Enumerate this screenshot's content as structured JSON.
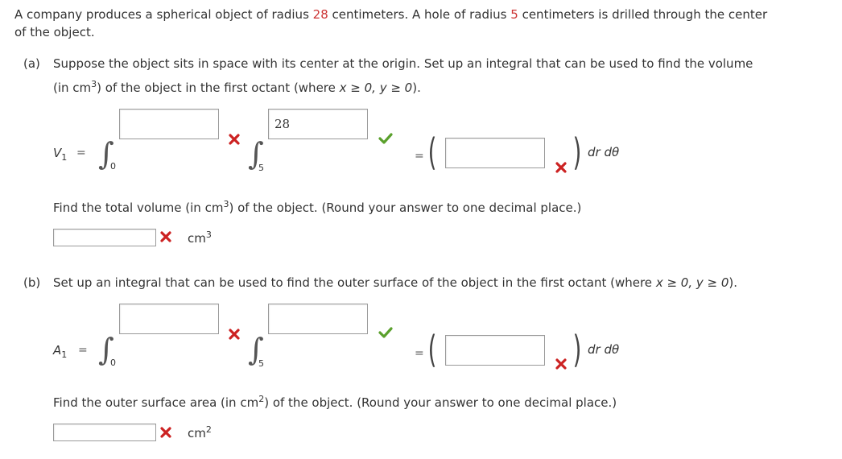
{
  "intro": {
    "text1": "A company produces a spherical object of radius ",
    "radius": "28",
    "text2": " centimeters. A hole of radius ",
    "hole": "5",
    "text3": " centimeters is drilled through the center",
    "line2": "of the object."
  },
  "part_a": {
    "label": "(a)",
    "q_line1": "Suppose the object sits in space with its center at the origin. Set up an integral that can be used to find the volume",
    "q_line2_pre": "(in cm",
    "q_line2_sup": "3",
    "q_line2_post": ") of the object in the first octant (where ",
    "cond": "x ≥ 0, y ≥ 0",
    "q_line2_end": ").",
    "lhs_var": "V",
    "lhs_sub": "1",
    "eq": "=",
    "int1_lower": "0",
    "int2_lower": "5",
    "box_upper1": "",
    "box_upper2": "28",
    "box_integrand": "",
    "dr": "dr",
    "dtheta": "dθ",
    "total_q_pre": "Find the total volume (in cm",
    "total_q_sup": "3",
    "total_q_post": ") of the object. (Round your answer to one decimal place.)",
    "answer": "",
    "unit": "cm",
    "unit_sup": "3"
  },
  "part_b": {
    "label": "(b)",
    "q_line": "Set up an integral that can be used to find the outer surface of the object in the first octant (where ",
    "cond": "x ≥ 0, y ≥ 0",
    "q_end": ").",
    "lhs_var": "A",
    "lhs_sub": "1",
    "eq": "=",
    "int1_lower": "0",
    "int2_lower": "5",
    "box_upper1": "",
    "box_upper2": "",
    "box_integrand": "",
    "dr": "dr",
    "dtheta": "dθ",
    "total_q_pre": "Find the outer surface area (in cm",
    "total_q_sup": "2",
    "total_q_post": ") of the object. (Round your answer to one decimal place.)",
    "answer": "",
    "unit": "cm",
    "unit_sup": "2"
  },
  "colors": {
    "highlight": "#cc3333",
    "correct": "#5aa02c",
    "incorrect": "#cc2222"
  },
  "icons": {
    "incorrect": "x-mark-icon",
    "correct": "check-mark-icon"
  }
}
